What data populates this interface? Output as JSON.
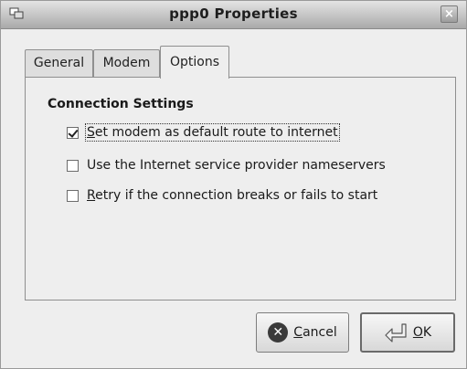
{
  "window": {
    "title": "ppp0 Properties",
    "close_glyph": "×",
    "icon": "network-icon"
  },
  "tabs": [
    {
      "label": "General",
      "active": false
    },
    {
      "label": "Modem",
      "active": false
    },
    {
      "label": "Options",
      "active": true
    }
  ],
  "connection_settings": {
    "heading": "Connection Settings",
    "options": [
      {
        "mnemonic": "S",
        "rest": "et modem as default route to internet",
        "checked": true,
        "focused": true
      },
      {
        "mnemonic": "",
        "rest": "Use the Internet service provider nameservers",
        "checked": false,
        "focused": false
      },
      {
        "mnemonic": "R",
        "rest": "etry if the connection breaks or fails to start",
        "checked": false,
        "focused": false
      }
    ]
  },
  "buttons": {
    "cancel": {
      "mnemonic": "C",
      "rest": "ancel",
      "icon": "cancel-icon"
    },
    "ok": {
      "mnemonic": "O",
      "rest": "K",
      "icon": "return-arrow-icon"
    }
  }
}
